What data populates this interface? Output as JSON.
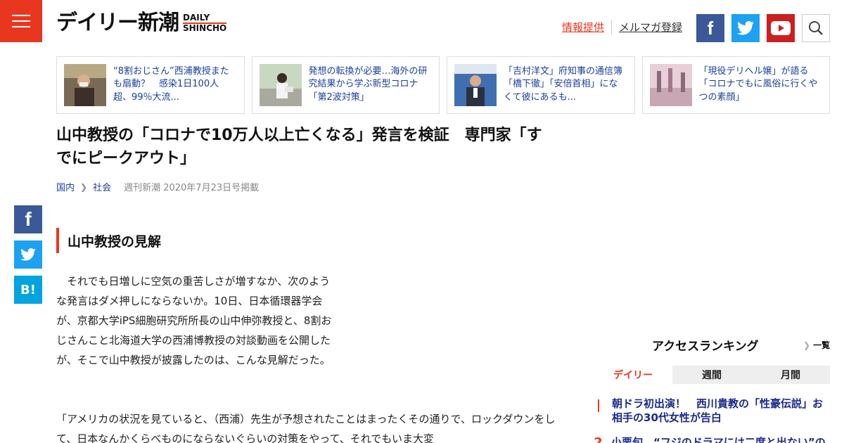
{
  "header": {
    "logo_jp": "デイリー新潮",
    "logo_en_line1": "DAILY",
    "logo_en_line2": "SHINCHO",
    "link_info": "情報提供",
    "link_mail": "メルマガ登録"
  },
  "cards": [
    {
      "text": "“8割おじさん”西浦教授またも扇動？　感染1日100人超、99％大流..."
    },
    {
      "text": "発想の転換が必要…海外の研究結果から学ぶ新型コロナ「第2波対策」"
    },
    {
      "text": "「吉村洋文」府知事の通信簿　「橋下徹」「安倍首相」になくて彼にあるも..."
    },
    {
      "text": "「現役デリヘル嬢」が語る「コロナでもに風俗に行くやつの素顔」"
    }
  ],
  "article": {
    "title": "山中教授の「コロナで10万人以上亡くなる」発言を検証　専門家「すでにピークアウト」",
    "category1": "国内",
    "category2": "社会",
    "published": "週刊新潮 2020年7月23日号掲載",
    "section_heading": "山中教授の見解",
    "para1": "　それでも日増しに空気の重苦しさが増すなか、次のような発言はダメ押しにならないか。10日、日本循環器学会が、京都大学iPS細胞研究所所長の山中伸弥教授と、8割おじさんこと北海道大学の西浦博教授の対談動画を公開したが、そこで山中教授が披露したのは、こんな見解だった。",
    "para2": "「アメリカの状況を見ていると、（西浦）先生が予想されたことはまったくその通りで、ロックダウンをして、日本なんかくらべものにならないぐらいの対策をやって、それでもいま大変"
  },
  "share": {
    "fb": "f",
    "tw": "t",
    "hb": "B!"
  },
  "ranking": {
    "title": "アクセスランキング",
    "more": "一覧",
    "tabs": [
      "デイリー",
      "週間",
      "月間"
    ],
    "items": [
      {
        "rank": "",
        "text": "朝ドラ初出演！　西川貴教の「性豪伝説」お相手の30代女性が告白"
      },
      {
        "rank": "2",
        "text": "小栗旬、“フジのドラマには二度と出ない”の激怒"
      }
    ]
  },
  "colors": {
    "brand_red": "#e8371e",
    "facebook": "#3b5998",
    "twitter": "#1da1f2",
    "youtube": "#cc1f1f",
    "link_blue": "#1a3e9c"
  }
}
